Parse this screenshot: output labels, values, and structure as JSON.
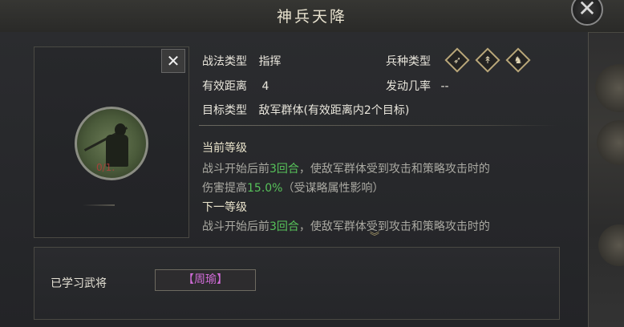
{
  "window": {
    "title": "神兵天降"
  },
  "tactic": {
    "labels": {
      "tactic_type": "战法类型",
      "effective_range": "有效距离",
      "target_type": "目标类型",
      "unit_type": "兵种类型",
      "trigger_rate": "发动几率"
    },
    "values": {
      "tactic_type": "指挥",
      "effective_range": "4",
      "target_type": "敌军群体(有效距离内2个目标)",
      "trigger_rate": "--"
    },
    "unit_type_icons": [
      "bow-icon",
      "spear-icon",
      "horse-icon"
    ]
  },
  "portrait": {
    "level_text": "0/1."
  },
  "levels": {
    "current_title": "当前等级",
    "current_desc_1": "战斗开始后前",
    "current_desc_turns": "3回合",
    "current_desc_2": "，使敌军群体受到攻击和策略攻击时的",
    "current_desc_3": "伤害提高",
    "current_desc_pct": "15.0%",
    "current_desc_4": "（受谋略属性影响）",
    "next_title": "下一等级",
    "next_desc_1": "战斗开始后前",
    "next_desc_turns": "3回合",
    "next_desc_2": "，使敌军群体受到攻击和策略攻击时的"
  },
  "learned": {
    "label": "已学习武将",
    "general": "【周瑜】"
  },
  "colors": {
    "highlight": "#57c25a",
    "general": "#cf6bd6",
    "title": "#e8e2cf"
  }
}
